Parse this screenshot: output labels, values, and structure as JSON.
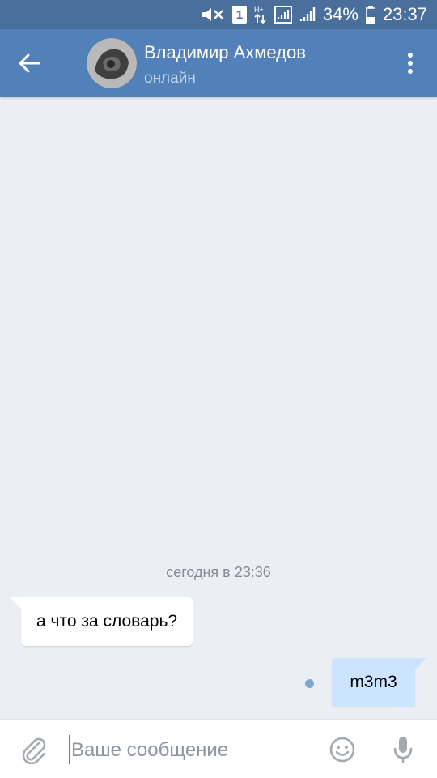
{
  "status_bar": {
    "battery_percent": "34%",
    "time": "23:37",
    "sim_number": "1",
    "network_label": "H+",
    "icons": [
      "mute-icon",
      "sim-icon",
      "data-arrows-icon",
      "signal-icon",
      "battery-icon"
    ]
  },
  "header": {
    "contact_name": "Владимир Ахмедов",
    "contact_status": "онлайн",
    "icons": [
      "back-arrow-icon",
      "more-vert-icon"
    ]
  },
  "chat": {
    "date_separator": "сегодня в 23:36",
    "messages": [
      {
        "direction": "incoming",
        "text": "а что за словарь?"
      },
      {
        "direction": "outgoing",
        "text": "m3m3",
        "unread": true
      }
    ]
  },
  "composer": {
    "placeholder": "Ваше сообщение",
    "value": "",
    "icons": [
      "paperclip-icon",
      "emoji-icon",
      "microphone-icon"
    ]
  },
  "colors": {
    "header": "#5181b8",
    "status_bar": "#4a6f9c",
    "chat_background": "#ebeff3",
    "incoming_bubble": "#ffffff",
    "outgoing_bubble": "#cce4ff",
    "unread_dot": "#7fa6d2"
  }
}
